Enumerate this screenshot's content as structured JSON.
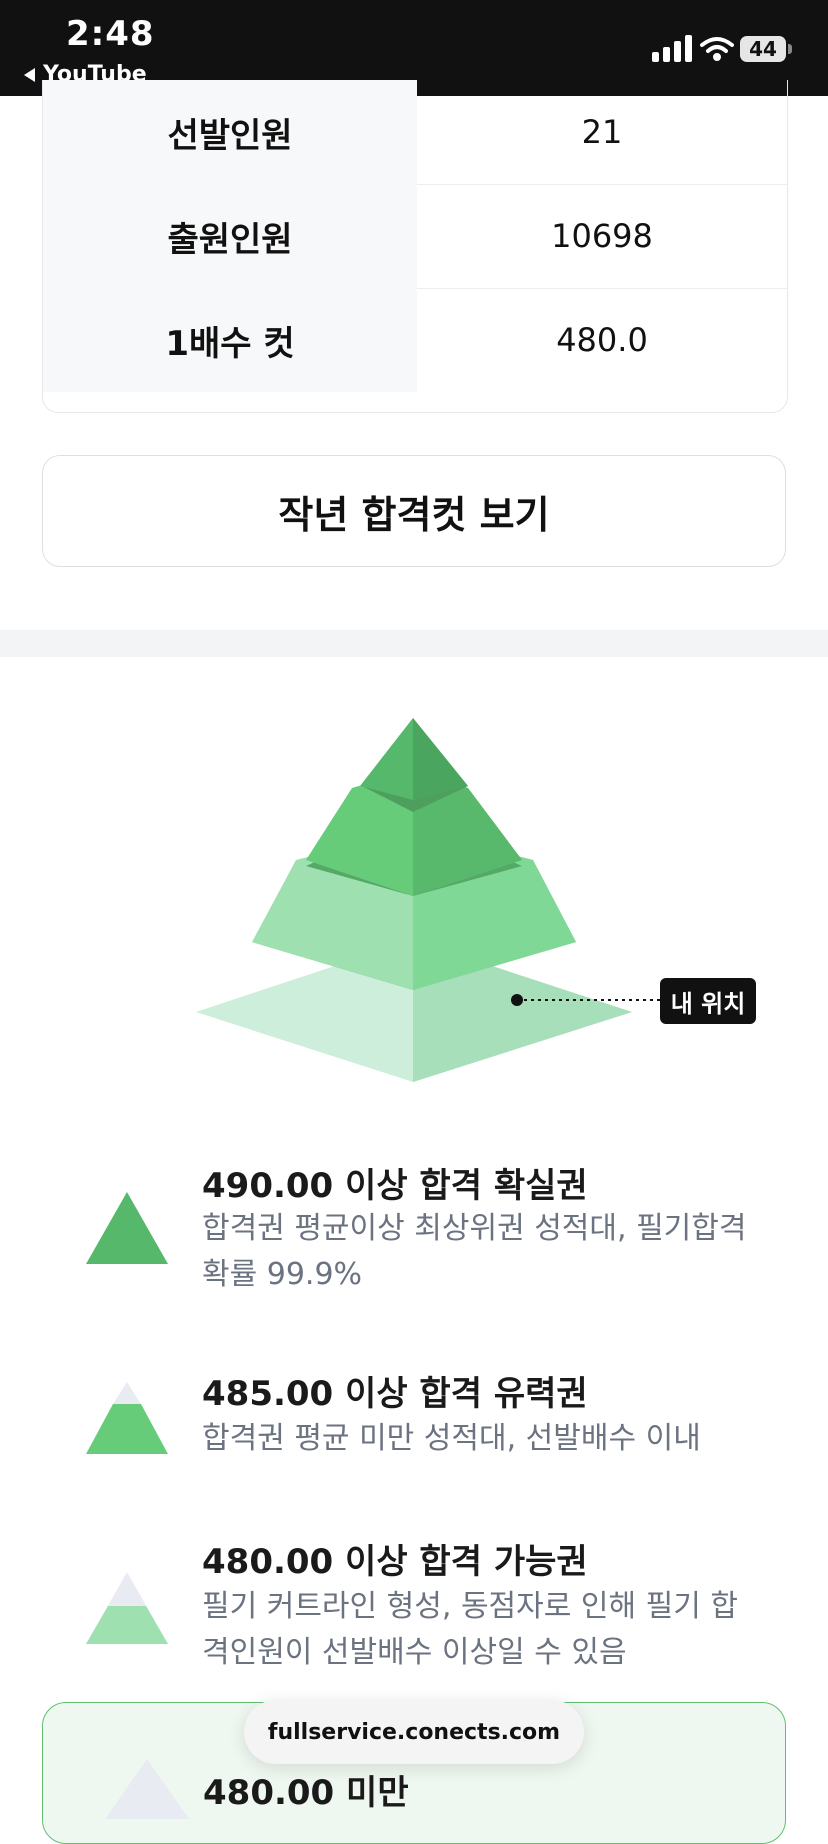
{
  "status_bar": {
    "time": "2:48",
    "back_app": "YouTube",
    "battery": "44"
  },
  "info_table": {
    "rows": [
      {
        "label": "선발인원",
        "value": "21"
      },
      {
        "label": "출원인원",
        "value": "10698"
      },
      {
        "label": "1배수 컷",
        "value": "480.0"
      }
    ]
  },
  "prev_cut_button": "작년 합격컷 보기",
  "pyramid": {
    "my_position_label": "내 위치"
  },
  "levels": [
    {
      "title": "490.00 이상 합격 확실권",
      "desc": "합격권 평균이상 최상위권 성적대, 필기합격 확률 99.9%",
      "icon": "pyramid-top-icon"
    },
    {
      "title": "485.00 이상 합격 유력권",
      "desc": "합격권 평균 미만 성적대, 선발배수 이내",
      "icon": "pyramid-upper-icon"
    },
    {
      "title": "480.00 이상 합격 가능권",
      "desc": "필기 커트라인 형성, 동점자로 인해 필기 합격인원이 선발배수 이상일 수 있음",
      "icon": "pyramid-middle-icon"
    }
  ],
  "last_level": {
    "title": "480.00 미만"
  },
  "url_bar": {
    "url": "fullservice.conects.com"
  },
  "colors": {
    "tier1": "#55b86a",
    "tier2": "#66cc7a",
    "tier3": "#9fe0b0",
    "tier4": "#cdeedb",
    "accent_border": "#5fc070",
    "muted_text": "#6b7280"
  }
}
